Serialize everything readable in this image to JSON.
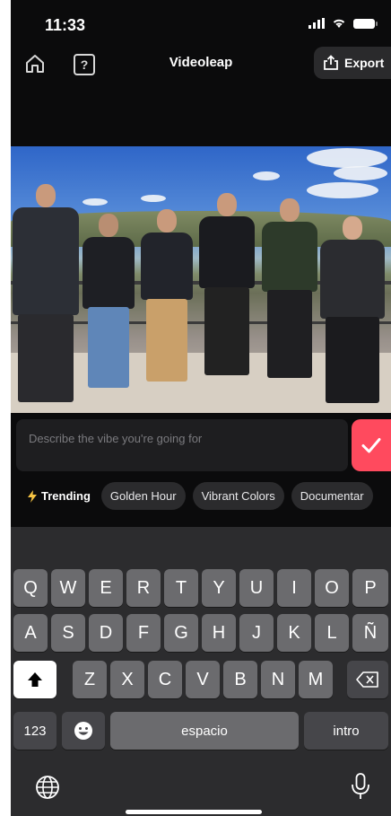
{
  "status_bar": {
    "time": "11:33"
  },
  "header": {
    "title": "Videoleap",
    "export_label": "Export",
    "help_label": "?"
  },
  "prompt": {
    "placeholder": "Describe the vibe you're going for"
  },
  "chips": {
    "trending_label": "Trending",
    "items": [
      "Golden Hour",
      "Vibrant Colors",
      "Documentar"
    ]
  },
  "keyboard": {
    "row1": [
      "Q",
      "W",
      "E",
      "R",
      "T",
      "Y",
      "U",
      "I",
      "O",
      "P"
    ],
    "row2": [
      "A",
      "S",
      "D",
      "F",
      "G",
      "H",
      "J",
      "K",
      "L",
      "Ñ"
    ],
    "row3": [
      "Z",
      "X",
      "C",
      "V",
      "B",
      "N",
      "M"
    ],
    "numbers_label": "123",
    "space_label": "espacio",
    "return_label": "intro"
  },
  "colors": {
    "accent": "#ff4a5e",
    "background": "#0b0b0c",
    "keyboard_bg": "#2c2c2e",
    "key": "#6b6b6e"
  },
  "icons": [
    "home-icon",
    "help-icon",
    "export-icon",
    "check-icon",
    "lightning-icon",
    "shift-icon",
    "backspace-icon",
    "emoji-icon",
    "globe-icon",
    "microphone-icon"
  ]
}
